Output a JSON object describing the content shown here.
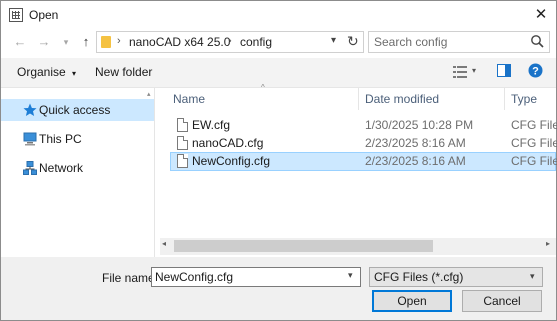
{
  "window": {
    "title": "Open"
  },
  "address": {
    "crumbs": [
      "nanoCAD x64 25.0",
      "config"
    ]
  },
  "search": {
    "placeholder": "Search config"
  },
  "toolbar": {
    "organise": "Organise",
    "new_folder": "New folder"
  },
  "nav": {
    "items": [
      {
        "label": "Quick access",
        "icon": "star-icon",
        "selected": true
      },
      {
        "label": "This PC",
        "icon": "computer-icon",
        "selected": false
      },
      {
        "label": "Network",
        "icon": "network-icon",
        "selected": false
      }
    ]
  },
  "list": {
    "columns": [
      "Name",
      "Date modified",
      "Type"
    ],
    "rows": [
      {
        "name": "EW.cfg",
        "date": "1/30/2025 10:28 PM",
        "type": "CFG File",
        "selected": false
      },
      {
        "name": "nanoCAD.cfg",
        "date": "2/23/2025 8:16 AM",
        "type": "CFG File",
        "selected": false
      },
      {
        "name": "NewConfig.cfg",
        "date": "2/23/2025 8:16 AM",
        "type": "CFG File",
        "selected": true
      }
    ]
  },
  "bottom": {
    "file_name_label": "File name:",
    "file_name_value": "NewConfig.cfg",
    "file_type_value": "CFG Files (*.cfg)",
    "open_label": "Open",
    "cancel_label": "Cancel"
  },
  "colors": {
    "accent": "#0078d7",
    "selection": "#cce8ff",
    "folder": "#f5c242",
    "quick_access_star": "#1e7ed6"
  }
}
